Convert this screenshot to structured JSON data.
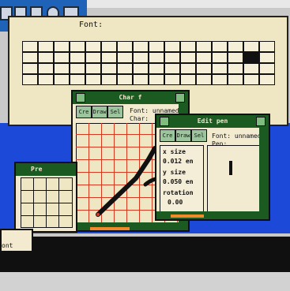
{
  "toolbar": {
    "icons": [
      {
        "name": "drive-icon"
      },
      {
        "name": "window-icon"
      },
      {
        "name": "document-icon"
      },
      {
        "name": "clock-icon"
      },
      {
        "name": "tool-icon"
      }
    ]
  },
  "main_window": {
    "font_label": "Font:"
  },
  "char_window": {
    "title": "Char f",
    "font_label": "Font: unnamed",
    "char_label": "Char:",
    "buttons": [
      "Cre",
      "Draw",
      "Sel"
    ]
  },
  "edit_window": {
    "title": "Edit pen",
    "font_label": "Font: unnamed",
    "pen_label": "Pen:",
    "buttons": [
      "Cre",
      "Draw",
      "Sel"
    ],
    "fields": [
      {
        "label": "x size",
        "value": "0.012 en"
      },
      {
        "label": "y size",
        "value": "0.050 en"
      },
      {
        "label": "rotation",
        "value": "0.00"
      }
    ],
    "values": []
  },
  "left_window": {
    "title": "Pre misc"
  },
  "bottom_left": {
    "label": "ont"
  }
}
